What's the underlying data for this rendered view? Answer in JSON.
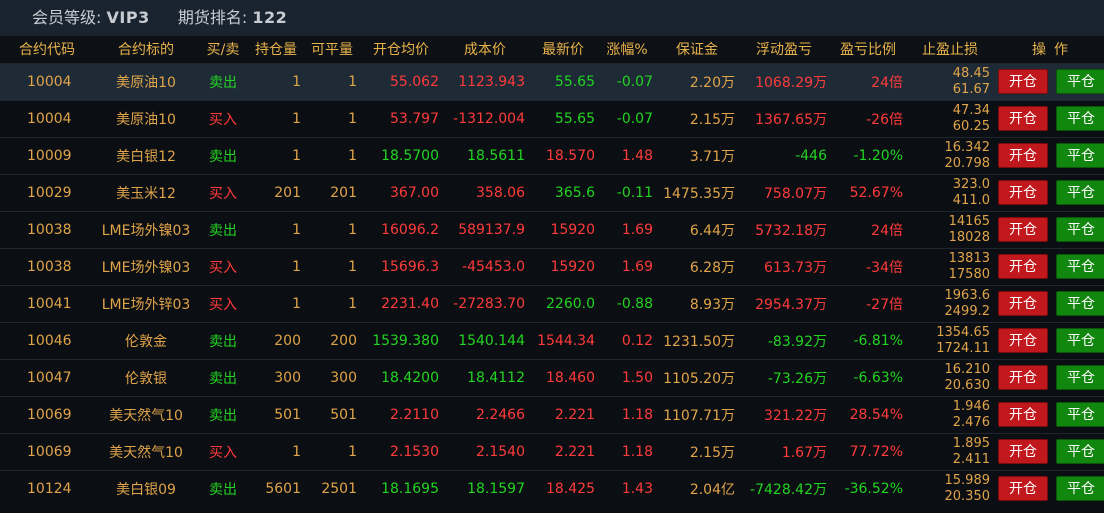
{
  "header": {
    "member_label": "会员等级:",
    "member_value": "VIP3",
    "rank_label": "期货排名:",
    "rank_value": "122"
  },
  "columns": {
    "code": "合约代码",
    "name": "合约标的",
    "side": "买/卖",
    "hold": "持仓量",
    "closable": "可平量",
    "open_avg": "开仓均价",
    "cost": "成本价",
    "last": "最新价",
    "change": "涨幅%",
    "margin": "保证金",
    "float_pl": "浮动盈亏",
    "pl_ratio": "盈亏比例",
    "stop": "止盈止损",
    "op1": "操",
    "op2": "作"
  },
  "buttons": {
    "open": "开仓",
    "close": "平仓"
  },
  "rows": [
    {
      "code": "10004",
      "name": "美原油10",
      "side": "卖出",
      "hold": "1",
      "closable": "1",
      "open_avg": "55.062",
      "cost": "1123.943",
      "last": "55.65",
      "change": "-0.07",
      "margin": "2.20万",
      "float_pl": "1068.29万",
      "pl_ratio": "24倍",
      "stop_hi": "48.45",
      "stop_lo": "61.67"
    },
    {
      "code": "10004",
      "name": "美原油10",
      "side": "买入",
      "hold": "1",
      "closable": "1",
      "open_avg": "53.797",
      "cost": "-1312.004",
      "last": "55.65",
      "change": "-0.07",
      "margin": "2.15万",
      "float_pl": "1367.65万",
      "pl_ratio": "-26倍",
      "stop_hi": "47.34",
      "stop_lo": "60.25"
    },
    {
      "code": "10009",
      "name": "美白银12",
      "side": "卖出",
      "hold": "1",
      "closable": "1",
      "open_avg": "18.5700",
      "cost": "18.5611",
      "last": "18.570",
      "change": "1.48",
      "margin": "3.71万",
      "float_pl": "-446",
      "pl_ratio": "-1.20%",
      "stop_hi": "16.342",
      "stop_lo": "20.798"
    },
    {
      "code": "10029",
      "name": "美玉米12",
      "side": "买入",
      "hold": "201",
      "closable": "201",
      "open_avg": "367.00",
      "cost": "358.06",
      "last": "365.6",
      "change": "-0.11",
      "margin": "1475.35万",
      "float_pl": "758.07万",
      "pl_ratio": "52.67%",
      "stop_hi": "323.0",
      "stop_lo": "411.0"
    },
    {
      "code": "10038",
      "name": "LME场外镍03",
      "side": "卖出",
      "hold": "1",
      "closable": "1",
      "open_avg": "16096.2",
      "cost": "589137.9",
      "last": "15920",
      "change": "1.69",
      "margin": "6.44万",
      "float_pl": "5732.18万",
      "pl_ratio": "24倍",
      "stop_hi": "14165",
      "stop_lo": "18028"
    },
    {
      "code": "10038",
      "name": "LME场外镍03",
      "side": "买入",
      "hold": "1",
      "closable": "1",
      "open_avg": "15696.3",
      "cost": "-45453.0",
      "last": "15920",
      "change": "1.69",
      "margin": "6.28万",
      "float_pl": "613.73万",
      "pl_ratio": "-34倍",
      "stop_hi": "13813",
      "stop_lo": "17580"
    },
    {
      "code": "10041",
      "name": "LME场外锌03",
      "side": "买入",
      "hold": "1",
      "closable": "1",
      "open_avg": "2231.40",
      "cost": "-27283.70",
      "last": "2260.0",
      "change": "-0.88",
      "margin": "8.93万",
      "float_pl": "2954.37万",
      "pl_ratio": "-27倍",
      "stop_hi": "1963.6",
      "stop_lo": "2499.2"
    },
    {
      "code": "10046",
      "name": "伦敦金",
      "side": "卖出",
      "hold": "200",
      "closable": "200",
      "open_avg": "1539.380",
      "cost": "1540.144",
      "last": "1544.34",
      "change": "0.12",
      "margin": "1231.50万",
      "float_pl": "-83.92万",
      "pl_ratio": "-6.81%",
      "stop_hi": "1354.65",
      "stop_lo": "1724.11"
    },
    {
      "code": "10047",
      "name": "伦敦银",
      "side": "卖出",
      "hold": "300",
      "closable": "300",
      "open_avg": "18.4200",
      "cost": "18.4112",
      "last": "18.460",
      "change": "1.50",
      "margin": "1105.20万",
      "float_pl": "-73.26万",
      "pl_ratio": "-6.63%",
      "stop_hi": "16.210",
      "stop_lo": "20.630"
    },
    {
      "code": "10069",
      "name": "美天然气10",
      "side": "卖出",
      "hold": "501",
      "closable": "501",
      "open_avg": "2.2110",
      "cost": "2.2466",
      "last": "2.221",
      "change": "1.18",
      "margin": "1107.71万",
      "float_pl": "321.22万",
      "pl_ratio": "28.54%",
      "stop_hi": "1.946",
      "stop_lo": "2.476"
    },
    {
      "code": "10069",
      "name": "美天然气10",
      "side": "买入",
      "hold": "1",
      "closable": "1",
      "open_avg": "2.1530",
      "cost": "2.1540",
      "last": "2.221",
      "change": "1.18",
      "margin": "2.15万",
      "float_pl": "1.67万",
      "pl_ratio": "77.72%",
      "stop_hi": "1.895",
      "stop_lo": "2.411"
    },
    {
      "code": "10124",
      "name": "美白银09",
      "side": "卖出",
      "hold": "5601",
      "closable": "2501",
      "open_avg": "18.1695",
      "cost": "18.1597",
      "last": "18.425",
      "change": "1.43",
      "margin": "2.04亿",
      "float_pl": "-7428.42万",
      "pl_ratio": "-36.52%",
      "stop_hi": "15.989",
      "stop_lo": "20.350"
    }
  ],
  "colors": {
    "header_bg": "#1a2430",
    "table_bg": "#0b0e12",
    "selected_row_bg": "#1e2a36",
    "orange_text": "#e0a44a",
    "red_text": "#ff3b3b",
    "green_text": "#22d422",
    "open_button": "#c0181c",
    "close_button": "#12870f"
  }
}
